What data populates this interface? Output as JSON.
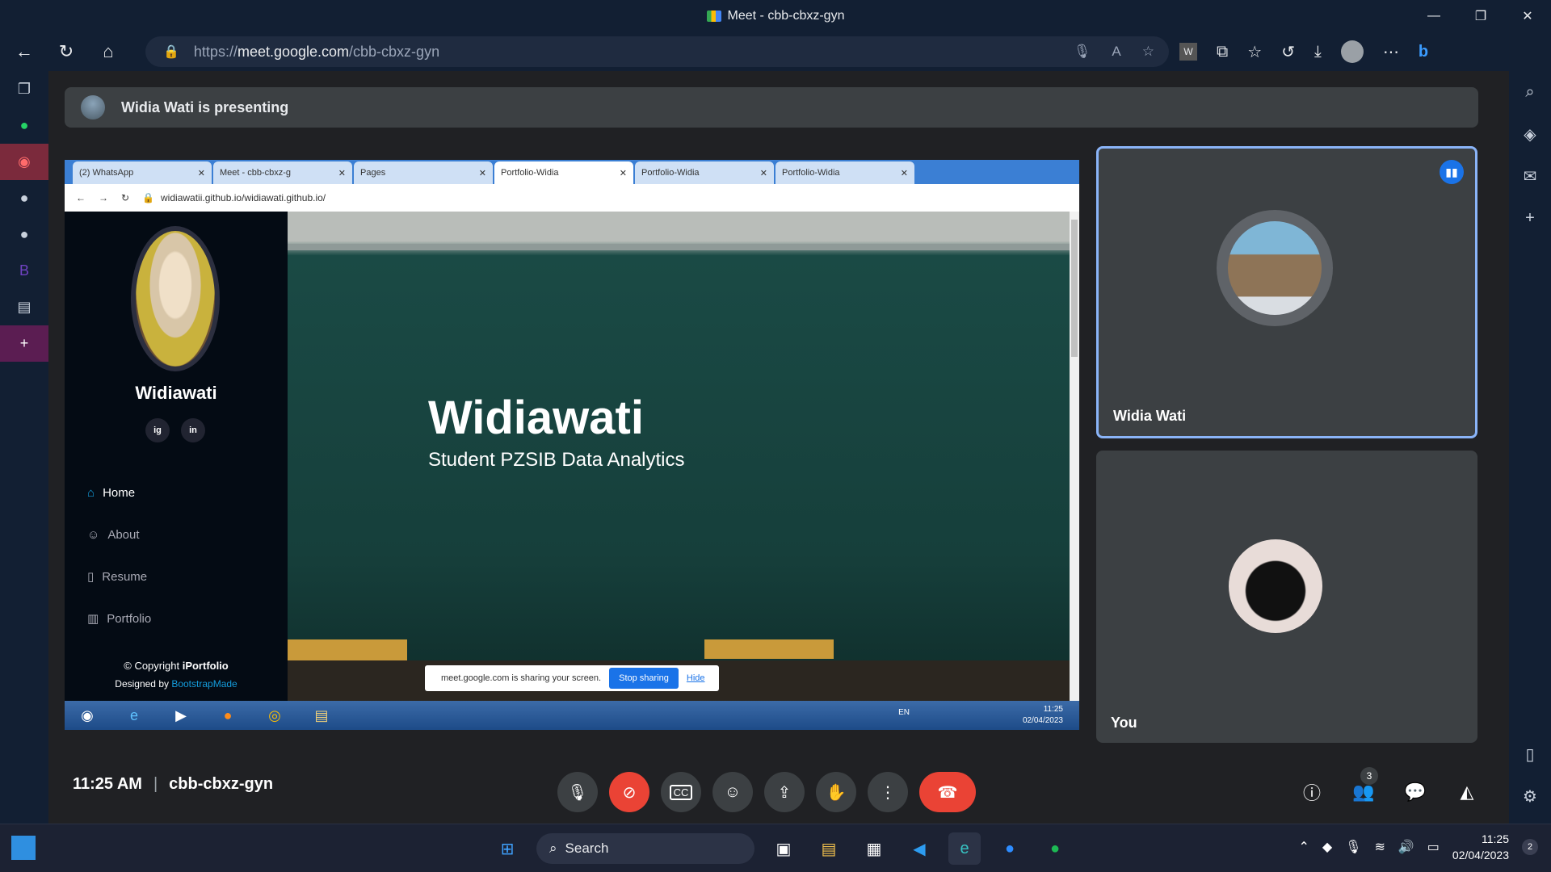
{
  "window": {
    "title": "Meet - cbb-cbxz-gyn"
  },
  "address_bar": {
    "url_prefix": "https://",
    "url_host": "meet.google.com",
    "url_path": "/cbb-cbxz-gyn"
  },
  "banner": {
    "text": "Widia Wati is presenting"
  },
  "shared_screen": {
    "tabs": [
      {
        "label": "(2) WhatsApp"
      },
      {
        "label": "Meet - cbb-cbxz-g"
      },
      {
        "label": "Pages"
      },
      {
        "label": "Portfolio-Widia"
      },
      {
        "label": "Portfolio-Widia"
      },
      {
        "label": "Portfolio-Widia"
      }
    ],
    "url": "widiawatii.github.io/widiawati.github.io/",
    "site": {
      "name": "Widiawati",
      "social": [
        "ig",
        "in"
      ],
      "nav": [
        {
          "label": "Home",
          "icon": "home-icon"
        },
        {
          "label": "About",
          "icon": "person-icon"
        },
        {
          "label": "Resume",
          "icon": "file-icon"
        },
        {
          "label": "Portfolio",
          "icon": "book-icon"
        }
      ],
      "copyright_prefix": "© Copyright ",
      "copyright_brand": "iPortfolio",
      "designed_prefix": "Designed by ",
      "designed_brand": "BootstrapMade",
      "hero_title": "Widiawati",
      "hero_subtitle": "Student PZSIB Data Analytics"
    },
    "share_notice": {
      "text": "meet.google.com is sharing your screen.",
      "stop": "Stop sharing",
      "hide": "Hide"
    },
    "xp_tray": {
      "lang": "EN",
      "time": "11:25",
      "date": "02/04/2023"
    }
  },
  "participants": [
    {
      "name": "Widia Wati",
      "speaking": true
    },
    {
      "name": "You",
      "speaking": false
    }
  ],
  "meeting": {
    "time": "11:25 AM",
    "code": "cbb-cbxz-gyn",
    "people_count": "3"
  },
  "taskbar": {
    "search_label": "Search",
    "time": "11:25",
    "date": "02/04/2023",
    "notifications": "2"
  }
}
